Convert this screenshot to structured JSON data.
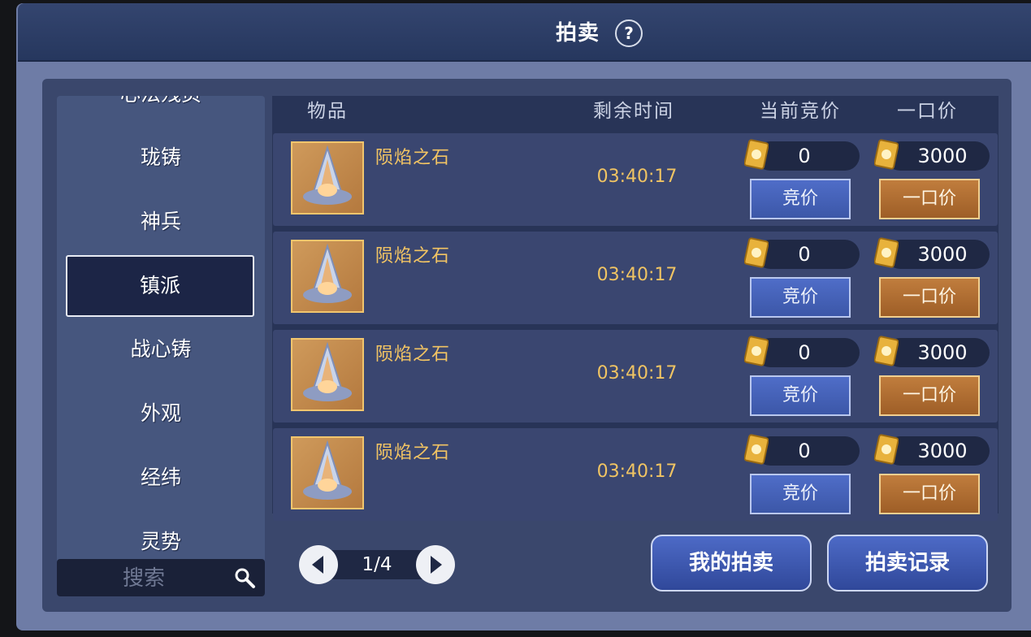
{
  "header": {
    "title": "拍卖",
    "help_label": "?"
  },
  "sidebar": {
    "items": [
      {
        "label": "心法残页"
      },
      {
        "label": "珑铸"
      },
      {
        "label": "神兵"
      },
      {
        "label": "镇派"
      },
      {
        "label": "战心铸"
      },
      {
        "label": "外观"
      },
      {
        "label": "经纬"
      },
      {
        "label": "灵势"
      }
    ],
    "active_item": "镇派",
    "search": {
      "placeholder": "搜索",
      "value": ""
    }
  },
  "table": {
    "columns": [
      "物品",
      "剩余时间",
      "当前竞价",
      "一口价"
    ],
    "rows": [
      {
        "name": "陨焰之石",
        "time_left": "03:40:17",
        "current_bid": "0",
        "buyout": "3000",
        "bid_label": "竞价",
        "buyout_label": "一口价"
      },
      {
        "name": "陨焰之石",
        "time_left": "03:40:17",
        "current_bid": "0",
        "buyout": "3000",
        "bid_label": "竞价",
        "buyout_label": "一口价"
      },
      {
        "name": "陨焰之石",
        "time_left": "03:40:17",
        "current_bid": "0",
        "buyout": "3000",
        "bid_label": "竞价",
        "buyout_label": "一口价"
      },
      {
        "name": "陨焰之石",
        "time_left": "03:40:17",
        "current_bid": "0",
        "buyout": "3000",
        "bid_label": "竞价",
        "buyout_label": "一口价"
      }
    ]
  },
  "pagination": {
    "page": "1/4"
  },
  "footer": {
    "my_auction_label": "我的拍卖",
    "auction_record_label": "拍卖记录"
  },
  "colors": {
    "accent_gold": "#f2c463",
    "bid_button": "#4f6dc8",
    "buyout_button": "#c07d3d",
    "panel": "#3a476c"
  },
  "icons": {
    "help": "question-circle-icon",
    "search": "magnifier-icon",
    "currency": "gold-ticket-icon",
    "item": "meteor-flame-stone-icon",
    "prev": "arrow-left-icon",
    "next": "arrow-right-icon"
  }
}
